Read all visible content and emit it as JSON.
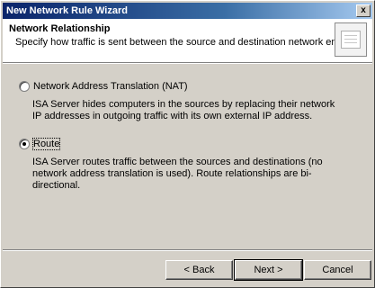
{
  "window": {
    "title": "New Network Rule Wizard",
    "close_glyph": "x"
  },
  "header": {
    "title": "Network Relationship",
    "subtitle": "Specify how traffic is sent between the source and destination network entities.",
    "icon": "wizard-page-icon"
  },
  "options": [
    {
      "label": "Network Address Translation (NAT)",
      "description": "ISA Server hides computers in the sources by replacing their network IP addresses in outgoing traffic with its own external IP address.",
      "selected": false
    },
    {
      "label": "Route",
      "description": "ISA Server routes traffic between the sources and destinations (no network address translation is used). Route relationships are bi-directional.",
      "selected": true
    }
  ],
  "buttons": {
    "back": "< Back",
    "next": "Next >",
    "cancel": "Cancel"
  }
}
